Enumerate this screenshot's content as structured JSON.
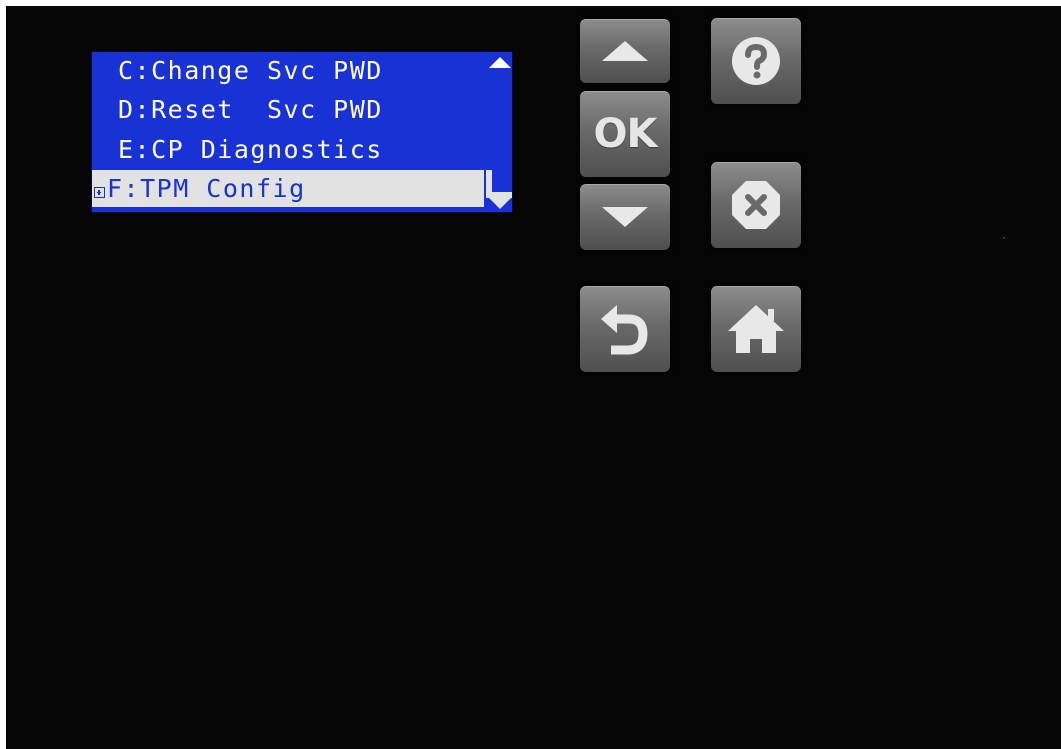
{
  "menu": {
    "items": [
      {
        "key": "C",
        "label": "C:Change Svc PWD"
      },
      {
        "key": "D",
        "label": "D:Reset  Svc PWD"
      },
      {
        "key": "E",
        "label": "E:CP Diagnostics"
      },
      {
        "key": "F",
        "label": "F:TPM Config",
        "selected": true,
        "expandable": true
      }
    ],
    "colors": {
      "background": "#1832d6",
      "text": "#ffffff",
      "selected_background": "#e2e2e2",
      "selected_text": "#1832d6"
    }
  },
  "buttons": {
    "up": {
      "icon": "triangle-up-icon"
    },
    "ok": {
      "label": "OK"
    },
    "down": {
      "icon": "triangle-down-icon"
    },
    "help": {
      "icon": "question-mark-icon"
    },
    "cancel": {
      "icon": "x-octagon-icon"
    },
    "back": {
      "icon": "back-arrow-icon"
    },
    "home": {
      "icon": "home-icon"
    }
  }
}
